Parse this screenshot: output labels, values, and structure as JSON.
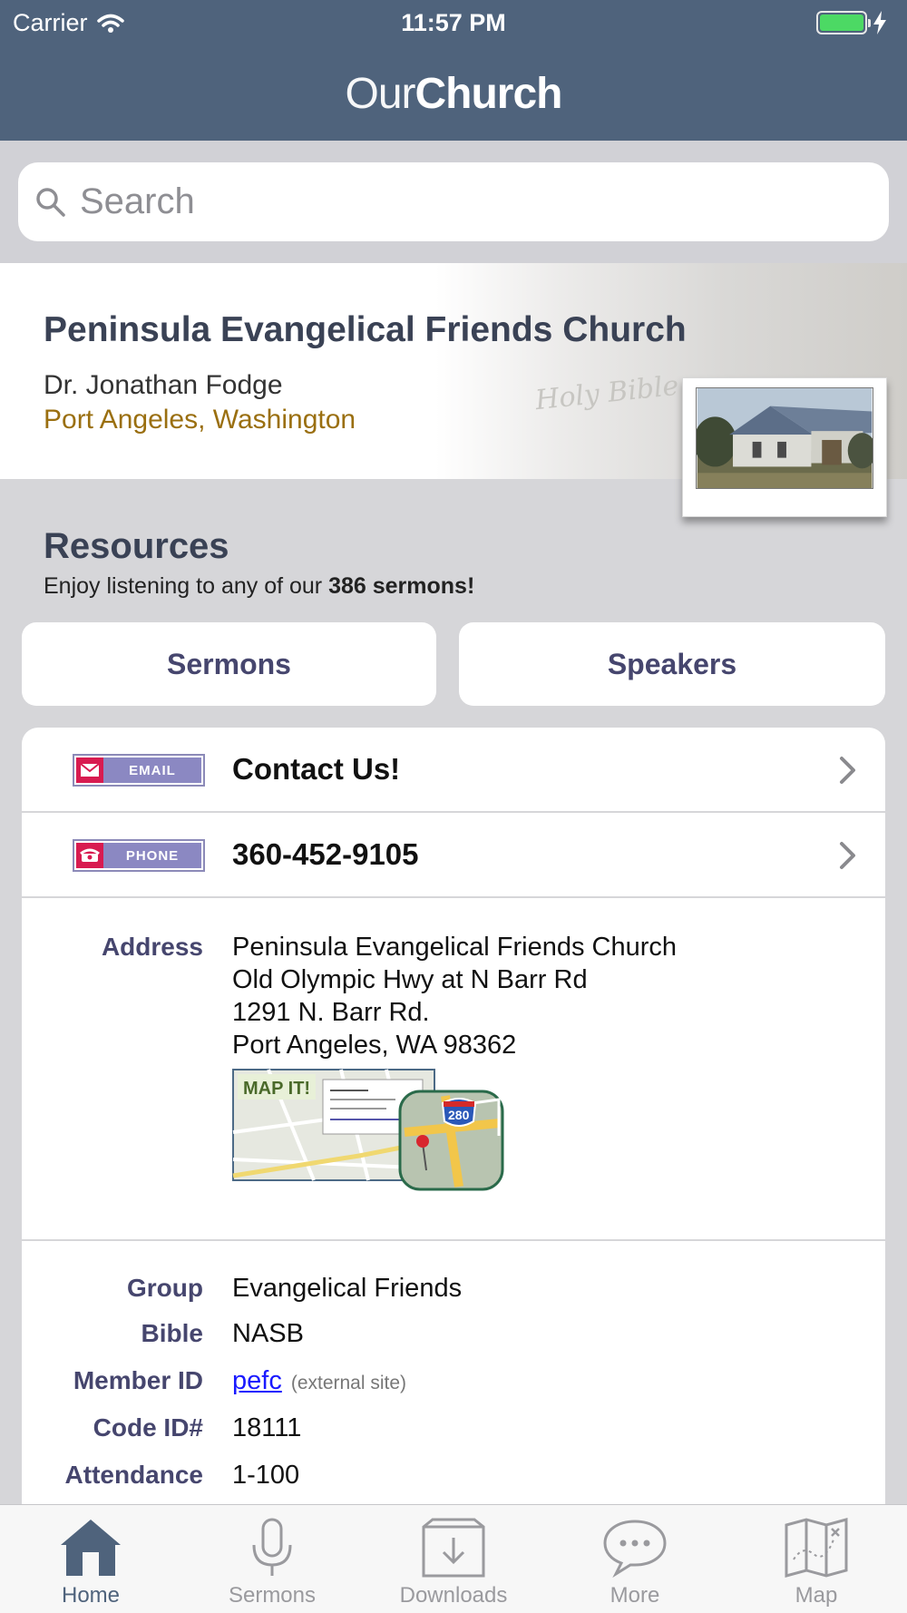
{
  "status_bar": {
    "carrier": "Carrier",
    "time": "11:57 PM",
    "battery_level": 1.0
  },
  "nav": {
    "title_light": "Our",
    "title_bold": "Church"
  },
  "search": {
    "placeholder": "Search"
  },
  "church": {
    "name": "Peninsula Evangelical Friends Church",
    "pastor": "Dr. Jonathan Fodge",
    "location": "Port Angeles, Washington",
    "photo_script_text": "Holy Bible"
  },
  "resources": {
    "heading": "Resources",
    "subtitle_prefix": "Enjoy listening to any of our ",
    "subtitle_bold": "386 sermons!",
    "buttons": {
      "sermons": "Sermons",
      "speakers": "Speakers"
    }
  },
  "contact": {
    "email_badge": "EMAIL",
    "email_label": "Contact Us!",
    "phone_badge": "PHONE",
    "phone_number": "360-452-9105"
  },
  "address": {
    "label": "Address",
    "lines": [
      "Peninsula Evangelical Friends Church",
      "Old Olympic Hwy at N Barr Rd",
      "1291 N. Barr Rd.",
      "Port Angeles, WA 98362"
    ],
    "map_button": "MAP IT!",
    "map_shield": "280"
  },
  "details": {
    "group_label": "Group",
    "group_value": "Evangelical Friends",
    "bible_label": "Bible",
    "bible_value": "NASB",
    "member_label": "Member ID",
    "member_value": "pefc",
    "member_note": "(external site)",
    "code_label": "Code ID#",
    "code_value": "18111",
    "attendance_label": "Attendance",
    "attendance_value": "1-100"
  },
  "tabs": [
    {
      "label": "Home",
      "icon": "home-icon",
      "active": true
    },
    {
      "label": "Sermons",
      "icon": "microphone-icon",
      "active": false
    },
    {
      "label": "Downloads",
      "icon": "download-box-icon",
      "active": false
    },
    {
      "label": "More",
      "icon": "chat-bubble-icon",
      "active": false
    },
    {
      "label": "Map",
      "icon": "folded-map-icon",
      "active": false
    }
  ],
  "colors": {
    "nav_bg": "#4f637c",
    "accent_text": "#46466e",
    "location_gold": "#9a6f10",
    "link_blue": "#1a1aff"
  }
}
